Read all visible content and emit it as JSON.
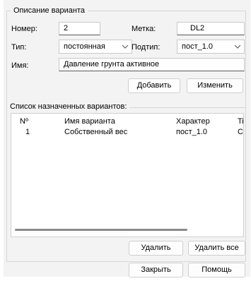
{
  "variant_group": {
    "title": "Описание варианта",
    "number_label": "Номер:",
    "number_value": "2",
    "mark_label": "Метка:",
    "mark_value": "DL2",
    "type_label": "Тип:",
    "type_value": "постоянная",
    "subtype_label": "Подтип:",
    "subtype_value": "пост_1.0",
    "name_label": "Имя:",
    "name_value": "Давление грунта активное",
    "add_button": "Добавить",
    "edit_button": "Изменить"
  },
  "assigned_group": {
    "title": "Список назначенных вариантов:",
    "columns": [
      "Nº",
      "Имя варианта",
      "Характер",
      "Ti"
    ],
    "rows": [
      [
        "1",
        "Собственный вес",
        "пост_1.0",
        "C"
      ]
    ],
    "delete_button": "Удалить",
    "delete_all_button": "Удалить все"
  },
  "footer": {
    "close_button": "Закрыть",
    "help_button": "Помощь"
  }
}
